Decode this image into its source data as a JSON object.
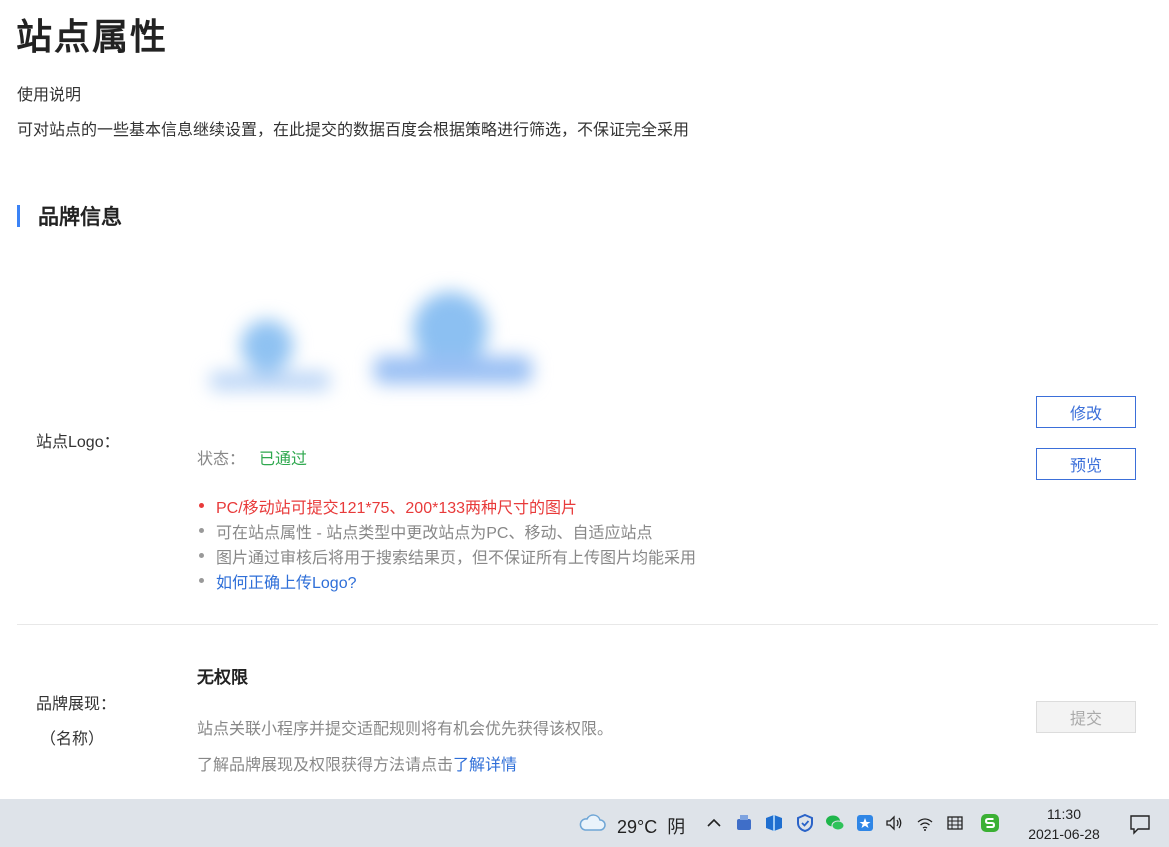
{
  "page": {
    "title": "站点属性",
    "usage_title": "使用说明",
    "usage_desc": "可对站点的一些基本信息继续设置，在此提交的数据百度会根据策略进行筛选，不保证完全采用"
  },
  "brand_section": {
    "title": "品牌信息",
    "logo": {
      "label": "站点Logo：",
      "status_label": "状态：",
      "status_value": "已通过",
      "tips": [
        "PC/移动站可提交121*75、200*133两种尺寸的图片",
        "可在站点属性 - 站点类型中更改站点为PC、移动、自适应站点",
        "图片通过审核后将用于搜索结果页，但不保证所有上传图片均能采用",
        "如何正确上传Logo?"
      ],
      "edit_button": "修改",
      "preview_button": "预览"
    },
    "brand_display": {
      "label_line1": "品牌展现：",
      "label_line2": "（名称）",
      "permission": "无权限",
      "desc": "站点关联小程序并提交适配规则将有机会优先获得该权限。",
      "more_prefix": "了解品牌展现及权限获得方法请点击",
      "more_link": "了解详情",
      "submit_button": "提交"
    }
  },
  "taskbar": {
    "weather_temp": "29°C",
    "weather_desc": "阴",
    "time": "11:30",
    "date": "2021-06-28",
    "tray_icons": [
      "usb-icon",
      "app-icon",
      "shield-icon",
      "wechat-icon",
      "star-app-icon",
      "volume-icon",
      "wifi-icon",
      "network-icon",
      "sogou-icon"
    ]
  },
  "colors": {
    "accent": "#3b6fd9",
    "section_bar": "#3b83f6",
    "success": "#2fa84f",
    "warning": "#e83a3a",
    "link": "#2f6fd8"
  }
}
